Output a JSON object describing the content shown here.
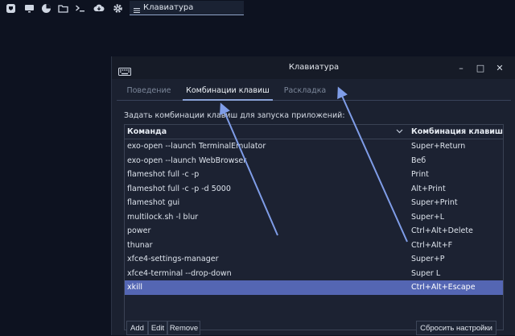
{
  "panel": {
    "icons": [
      "menu-icon",
      "monitor-icon",
      "pie-icon",
      "folder-icon",
      "terminal-icon",
      "cloud-download-icon",
      "gear-icon"
    ],
    "taskbar_item": {
      "label": "Клавиатура",
      "icon": "list-icon"
    }
  },
  "window": {
    "title": "Клавиатура",
    "icon": "keyboard-icon",
    "controls": {
      "minimize": "–",
      "maximize": "□",
      "close": "✕"
    }
  },
  "tabs": [
    {
      "label": "Поведение",
      "active": false
    },
    {
      "label": "Комбинации клавиш",
      "active": true
    },
    {
      "label": "Раскладка",
      "active": false
    }
  ],
  "caption": "Задать комбинации клавиш для запуска приложений:",
  "table": {
    "columns": [
      "Команда",
      "Комбинация клавиш"
    ],
    "rows": [
      {
        "command": "exo-open --launch TerminalEmulator",
        "shortcut": "Super+Return"
      },
      {
        "command": "exo-open --launch WebBrowser",
        "shortcut": "Веб"
      },
      {
        "command": "flameshot full -c -p",
        "shortcut": "Print"
      },
      {
        "command": "flameshot full -c -p -d 5000",
        "shortcut": "Alt+Print"
      },
      {
        "command": "flameshot gui",
        "shortcut": "Super+Print"
      },
      {
        "command": "multilock.sh -l blur",
        "shortcut": "Super+L"
      },
      {
        "command": "power",
        "shortcut": "Ctrl+Alt+Delete"
      },
      {
        "command": "thunar",
        "shortcut": "Ctrl+Alt+F"
      },
      {
        "command": "xfce4-settings-manager",
        "shortcut": "Super+P"
      },
      {
        "command": "xfce4-terminal --drop-down",
        "shortcut": "Super L"
      },
      {
        "command": "xkill",
        "shortcut": "Ctrl+Alt+Escape",
        "selected": true
      }
    ]
  },
  "buttons": {
    "add": "Add",
    "edit": "Edit",
    "remove": "Remove",
    "reset": "Сбросить настройки"
  },
  "colors": {
    "accent": "#5466b3",
    "annotation_arrow": "#7f9de8",
    "background": "#0d1220",
    "window": "#1b2130"
  }
}
